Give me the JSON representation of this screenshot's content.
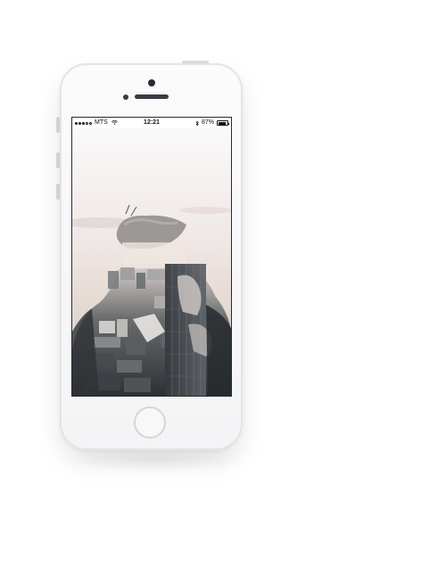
{
  "status_bar": {
    "carrier": "MTS",
    "time": "12:21",
    "battery_percent": "87%",
    "battery_level": 0.87,
    "signal_bars_filled": 3,
    "signal_bars_total": 5,
    "icons": [
      "signal-dots-icon",
      "wifi-icon",
      "bluetooth-icon",
      "battery-icon"
    ]
  },
  "wallpaper": {
    "description_icon": "double-exposure-photo",
    "colors": {
      "sky": "#efe9ea",
      "city": "#4a4e52",
      "shadow": "#1e2226"
    }
  },
  "device": {
    "model_icon": "iphone-white-icon",
    "body_color": "#f7f7f8"
  }
}
